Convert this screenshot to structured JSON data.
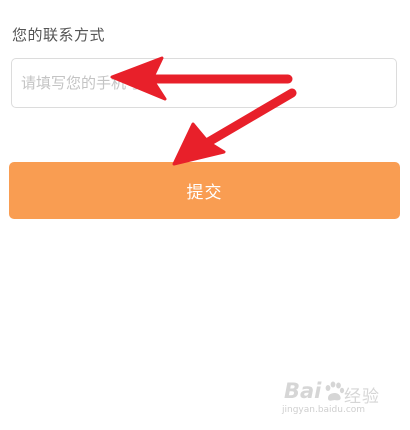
{
  "contact_section": {
    "label": "您的联系方式",
    "input_value": "",
    "input_placeholder": "请填写您的手机号码"
  },
  "submit": {
    "label": "提交",
    "color": "#f99d52",
    "text_color": "#ffffff"
  },
  "annotation": {
    "arrow_color": "#e8202a",
    "icon": "red-arrow-icon"
  },
  "watermark": {
    "brand": "Bai",
    "paw_icon": "paw-icon",
    "brand_suffix": "经验",
    "url": "jingyan.baidu.com"
  }
}
